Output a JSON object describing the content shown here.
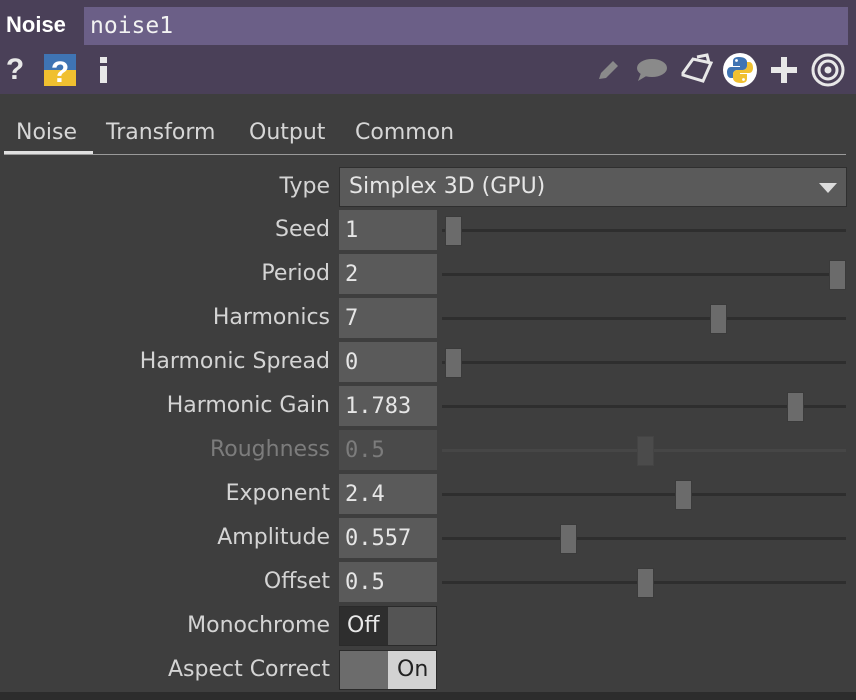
{
  "header": {
    "op_type": "Noise",
    "op_name": "noise1",
    "icons": [
      "help-icon",
      "python-help-icon",
      "info-icon",
      "pencil-icon",
      "comment-icon",
      "clone-icon",
      "python-icon",
      "add-icon",
      "viewer-icon"
    ]
  },
  "tabs": [
    {
      "label": "Noise",
      "active": true
    },
    {
      "label": "Transform",
      "active": false
    },
    {
      "label": "Output",
      "active": false
    },
    {
      "label": "Common",
      "active": false
    }
  ],
  "params": {
    "type": {
      "label": "Type",
      "value": "Simplex 3D (GPU)"
    },
    "seed": {
      "label": "Seed",
      "value": "1",
      "level": 0.0
    },
    "period": {
      "label": "Period",
      "value": "2",
      "level": 1.0
    },
    "harmonics": {
      "label": "Harmonics",
      "value": "7",
      "level": 0.69
    },
    "harmonic_spread": {
      "label": "Harmonic Spread",
      "value": "0",
      "level": 0.0
    },
    "harmonic_gain": {
      "label": "Harmonic Gain",
      "value": "1.783",
      "level": 0.89
    },
    "roughness": {
      "label": "Roughness",
      "value": "0.5",
      "level": 0.5,
      "disabled": true
    },
    "exponent": {
      "label": "Exponent",
      "value": "2.4",
      "level": 0.6
    },
    "amplitude": {
      "label": "Amplitude",
      "value": "0.557",
      "level": 0.3
    },
    "offset": {
      "label": "Offset",
      "value": "0.5",
      "level": 0.5
    },
    "monochrome": {
      "label": "Monochrome",
      "value": "Off"
    },
    "aspect_correct": {
      "label": "Aspect Correct",
      "value": "On"
    }
  },
  "colors": {
    "header_bg": "#4a4058",
    "name_field_bg": "#6b5f87",
    "panel_bg": "#3e3e3e",
    "field_bg": "#5a5a5a"
  }
}
